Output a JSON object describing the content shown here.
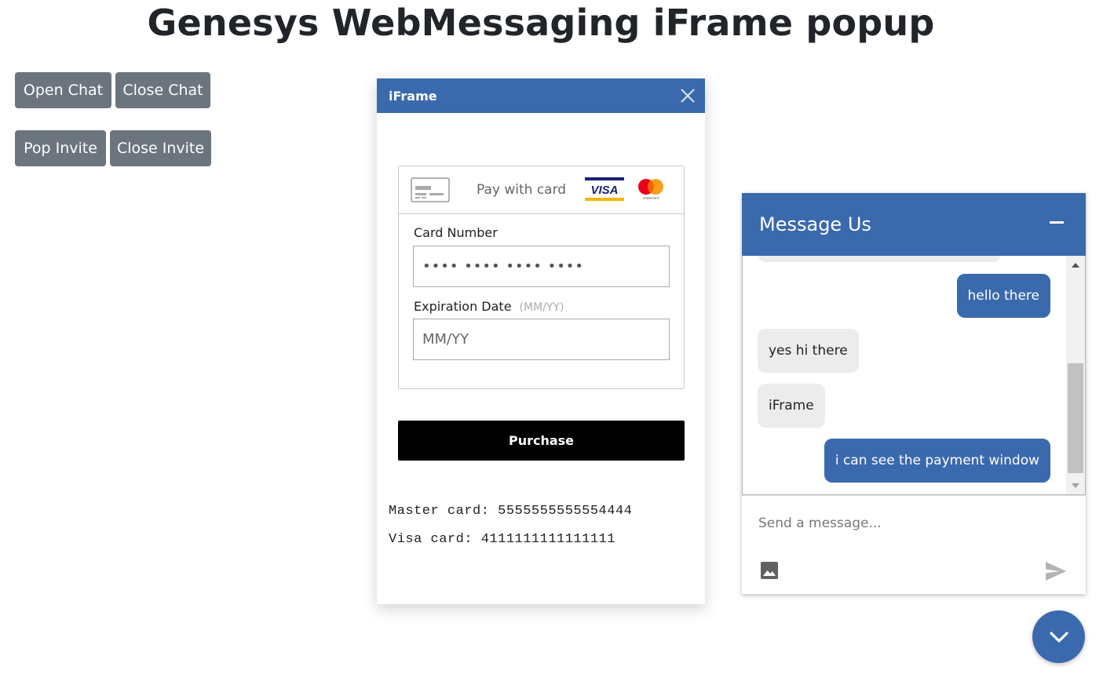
{
  "page": {
    "title": "Genesys WebMessaging iFrame popup"
  },
  "controls": {
    "open_chat": "Open Chat",
    "close_chat": "Close Chat",
    "pop_invite": "Pop Invite",
    "close_invite": "Close Invite"
  },
  "iframe_popup": {
    "title": "iFrame",
    "close_icon": "close-icon",
    "payment": {
      "pay_label": "Pay with card",
      "card_brands": [
        "VISA",
        "mastercard"
      ],
      "card_number_label": "Card Number",
      "card_number_value": "•••• •••• •••• ••••",
      "expiration_label": "Expiration Date",
      "expiration_hint": "(MM/YY)",
      "expiration_placeholder": "MM/YY",
      "purchase_label": "Purchase"
    },
    "test_cards": [
      "Master card: 5555555555554444",
      "Visa card: 4111111111111111"
    ]
  },
  "messenger": {
    "title": "Message Us",
    "messages": [
      {
        "direction": "outbound",
        "text": "hello there"
      },
      {
        "direction": "inbound",
        "text": "yes hi there"
      },
      {
        "direction": "inbound",
        "text": "iFrame"
      },
      {
        "direction": "outbound",
        "text": "i can see the payment window"
      }
    ],
    "composer_placeholder": "Send a message...",
    "icons": [
      "minimize-icon",
      "image-attach-icon",
      "send-icon",
      "chevron-down-icon"
    ]
  },
  "colors": {
    "brand_blue": "#3a69ae",
    "button_gray": "#6c757d",
    "bubble_gray": "#ececec",
    "purchase_black": "#000000"
  }
}
